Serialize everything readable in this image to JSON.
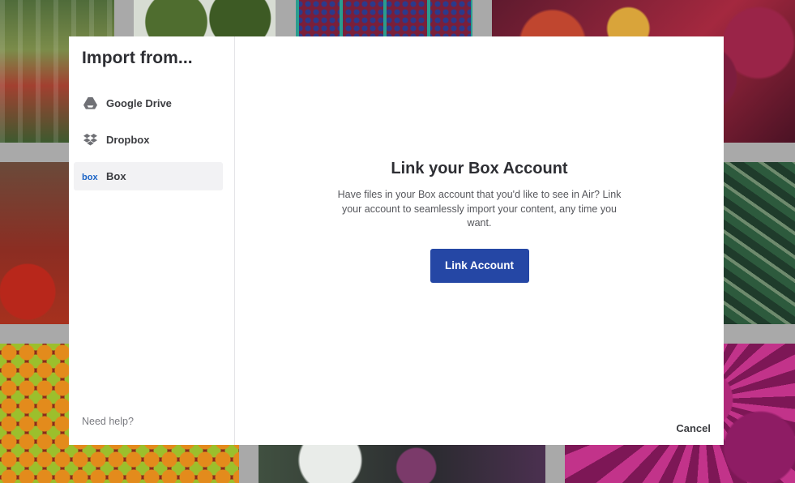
{
  "modal": {
    "title": "Import from...",
    "sources": [
      {
        "label": "Google Drive",
        "icon": "google-drive-icon",
        "active": false
      },
      {
        "label": "Dropbox",
        "icon": "dropbox-icon",
        "active": false
      },
      {
        "label": "Box",
        "icon": "box-icon",
        "active": true
      }
    ],
    "help_link": "Need help?",
    "content": {
      "heading": "Link your Box Account",
      "description": "Have files in your Box account that you'd like to see in Air? Link your account to seamlessly import your content, any time you want.",
      "link_button": "Link Account"
    },
    "cancel": "Cancel"
  },
  "colors": {
    "primary_button": "#2547a5",
    "box_brand": "#1a63c6",
    "active_item_bg": "#f2f2f4"
  }
}
